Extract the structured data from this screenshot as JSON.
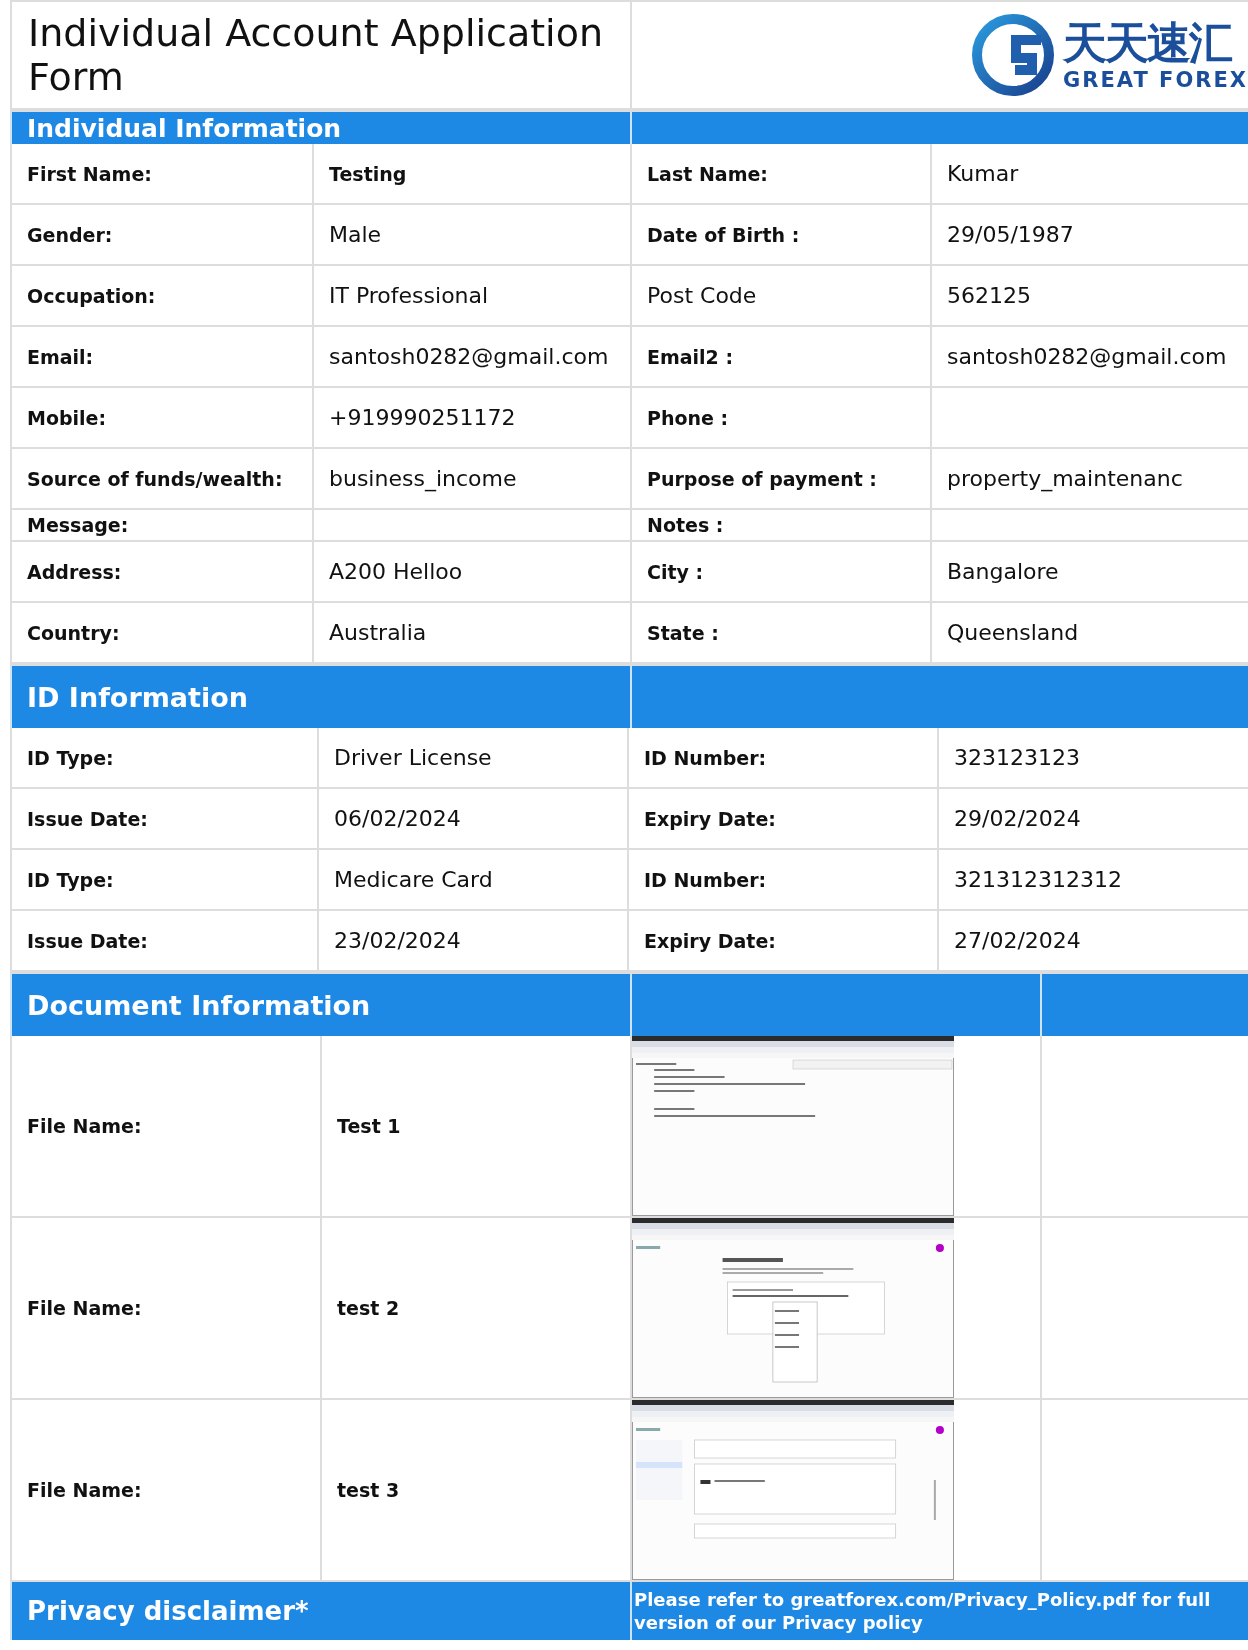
{
  "title": "Individual Account Application Form",
  "logo": {
    "chinese": "天天速汇",
    "english": "GREAT FOREX"
  },
  "individual_information": {
    "heading": "Individual Information",
    "rows": [
      {
        "kind": "normal",
        "cells": [
          {
            "text": "First Name:",
            "bold": true
          },
          {
            "text": "Testing",
            "bold": true
          },
          {
            "text": "Last Name:",
            "bold": true
          },
          {
            "text": "Kumar",
            "bold": false
          }
        ]
      },
      {
        "kind": "normal",
        "cells": [
          {
            "text": "Gender:",
            "bold": true
          },
          {
            "text": "Male",
            "bold": false
          },
          {
            "text": "Date of Birth :",
            "bold": true
          },
          {
            "text": "29/05/1987",
            "bold": false
          }
        ]
      },
      {
        "kind": "normal",
        "cells": [
          {
            "text": "Occupation:",
            "bold": true
          },
          {
            "text": "IT Professional",
            "bold": false
          },
          {
            "text": "Post Code",
            "bold": false
          },
          {
            "text": "562125",
            "bold": false
          }
        ]
      },
      {
        "kind": "normal",
        "cells": [
          {
            "text": "Email:",
            "bold": true
          },
          {
            "text": "santosh0282@gmail.com",
            "bold": false
          },
          {
            "text": "Email2 :",
            "bold": true
          },
          {
            "text": "santosh0282@gmail.com",
            "bold": false
          }
        ]
      },
      {
        "kind": "normal",
        "cells": [
          {
            "text": "Mobile:",
            "bold": true
          },
          {
            "text": "+919990251172",
            "bold": false
          },
          {
            "text": "Phone :",
            "bold": true
          },
          {}
        ]
      },
      {
        "kind": "normal",
        "cells": [
          {
            "text": "Source of funds/wealth:",
            "bold": true
          },
          {
            "text": "business_income",
            "bold": false
          },
          {
            "text": "Purpose of payment :",
            "bold": true
          },
          {
            "text": "property_maintenanc",
            "bold": false
          }
        ]
      },
      {
        "kind": "compact",
        "cells": [
          {
            "text": "Message:",
            "bold": true
          },
          {},
          {
            "text": "Notes :",
            "bold": true
          },
          {}
        ]
      },
      {
        "kind": "normal",
        "cells": [
          {
            "text": "Address:",
            "bold": true
          },
          {
            "text": "A200 Helloo",
            "bold": false
          },
          {
            "text": "City :",
            "bold": true
          },
          {
            "text": "Bangalore",
            "bold": false
          }
        ]
      },
      {
        "kind": "normal",
        "cells": [
          {
            "text": "Country:",
            "bold": true
          },
          {
            "text": "Australia",
            "bold": false
          },
          {
            "text": "State :",
            "bold": true
          },
          {
            "text": "Queensland",
            "bold": false
          }
        ]
      }
    ]
  },
  "id_information": {
    "heading": "ID Information",
    "rows": [
      {
        "cells": [
          {
            "text": "ID Type:",
            "bold": true
          },
          {
            "text": "Driver License",
            "bold": false
          },
          {
            "text": "ID Number:",
            "bold": true
          },
          {
            "text": "323123123",
            "bold": false
          }
        ]
      },
      {
        "cells": [
          {
            "text": "Issue Date:",
            "bold": true
          },
          {
            "text": "06/02/2024",
            "bold": false
          },
          {
            "text": "Expiry Date:",
            "bold": true
          },
          {
            "text": "29/02/2024",
            "bold": false
          }
        ]
      },
      {
        "cells": [
          {
            "text": "ID Type:",
            "bold": true
          },
          {
            "text": "Medicare Card",
            "bold": false
          },
          {
            "text": "ID Number:",
            "bold": true
          },
          {
            "text": "321312312312",
            "bold": false
          }
        ]
      },
      {
        "cells": [
          {
            "text": "Issue Date:",
            "bold": true
          },
          {
            "text": "23/02/2024",
            "bold": false
          },
          {
            "text": "Expiry Date:",
            "bold": true
          },
          {
            "text": "27/02/2024",
            "bold": false
          }
        ]
      }
    ]
  },
  "document_information": {
    "heading": "Document Information",
    "rows": [
      {
        "label": "File Name:",
        "file_name": "Test 1",
        "kind": "email"
      },
      {
        "label": "File Name:",
        "file_name": "test 2",
        "kind": "passwords"
      },
      {
        "label": "File Name:",
        "file_name": "test 3",
        "kind": "security"
      }
    ]
  },
  "privacy": {
    "heading": "Privacy disclaimer*",
    "note": "Please refer to greatforex.com/Privacy_Policy.pdf for full version of our Privacy policy"
  }
}
